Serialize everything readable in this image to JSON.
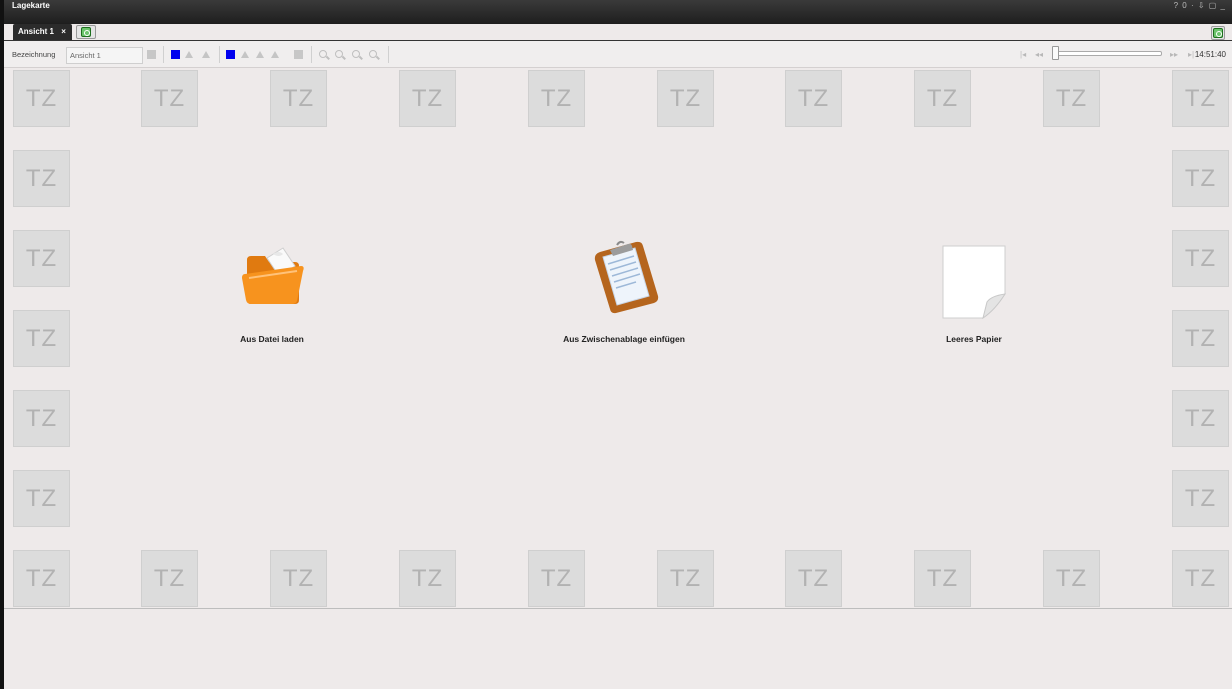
{
  "window": {
    "title": "Lagekarte",
    "controls": "? 0 · ⇩ ▢ _"
  },
  "tabs": [
    {
      "label": "Ansicht 1",
      "close": "×"
    }
  ],
  "toolbar": {
    "name_label": "Bezeichnung",
    "name_value": "Ansicht 1"
  },
  "playback": {
    "first": "|◂",
    "prev": "◂◂",
    "next": "▸▸",
    "last": "▸|",
    "time": "14:51:40"
  },
  "tiles": {
    "text": "TZ"
  },
  "actions": {
    "load": "Aus Datei laden",
    "paste": "Aus Zwischenablage einfügen",
    "blank": "Leeres Papier"
  },
  "colors": {
    "accent_blue": "#0000ee",
    "refresh_green": "#6cc46c",
    "folder_orange": "#f7931e"
  }
}
